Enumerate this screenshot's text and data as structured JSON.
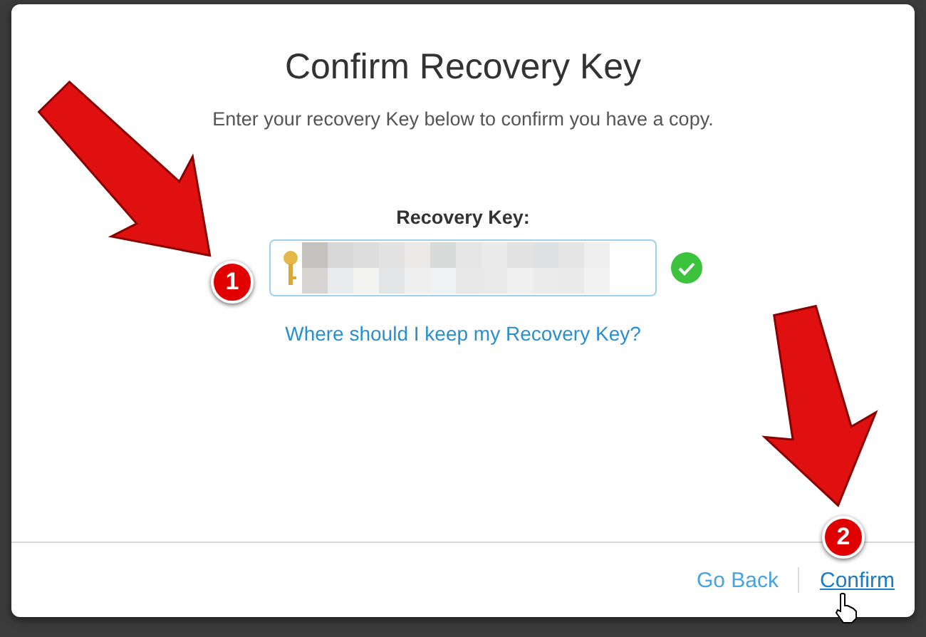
{
  "dialog": {
    "title": "Confirm Recovery Key",
    "subtitle": "Enter your recovery Key below to confirm you have a copy.",
    "field": {
      "label": "Recovery Key:",
      "valid": true
    },
    "help_link": "Where should I keep my Recovery Key?",
    "buttons": [
      {
        "label": "Go Back",
        "hovered": false
      },
      {
        "label": "Confirm",
        "hovered": true
      }
    ]
  },
  "annotations": [
    {
      "number": "1"
    },
    {
      "number": "2"
    }
  ]
}
